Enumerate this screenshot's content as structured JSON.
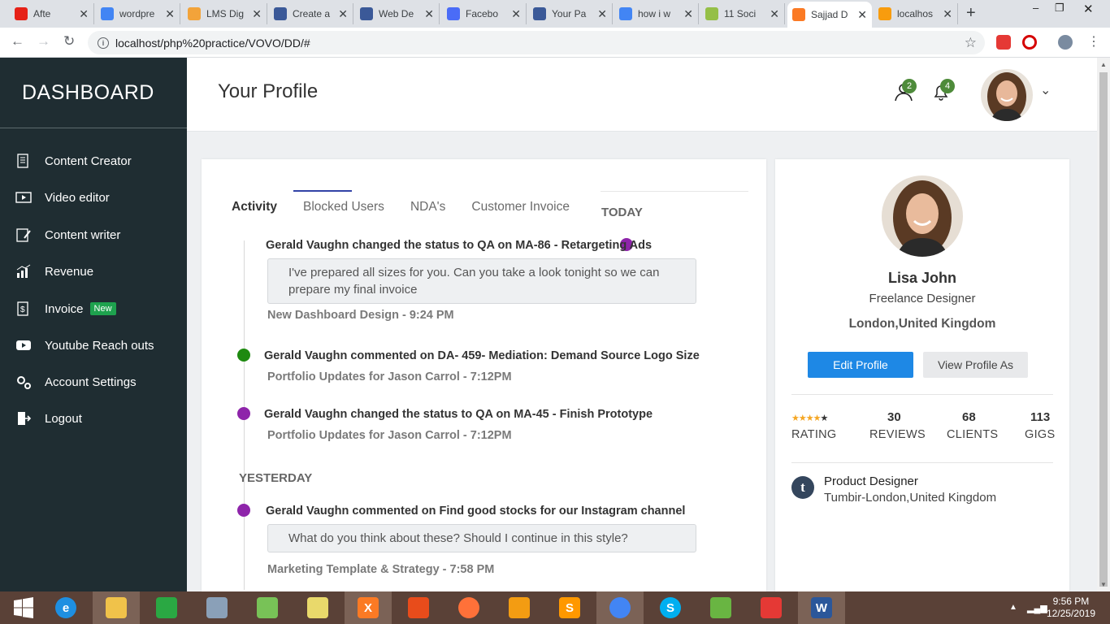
{
  "browser": {
    "tabs": [
      {
        "title": "Afte",
        "favicon": "youtube-icon",
        "color": "#e62117"
      },
      {
        "title": "wordpre",
        "favicon": "google-icon",
        "color": "#4285f4"
      },
      {
        "title": "LMS Dig",
        "favicon": "lms-icon",
        "color": "#f2a33a"
      },
      {
        "title": "Create a",
        "favicon": "facebook-icon",
        "color": "#3b5998"
      },
      {
        "title": "Web De",
        "favicon": "facebook-icon",
        "color": "#3b5998"
      },
      {
        "title": "Facebo",
        "favicon": "c-icon",
        "color": "#4a6cf7"
      },
      {
        "title": "Your Pa",
        "favicon": "facebook-icon",
        "color": "#3b5998"
      },
      {
        "title": "how i w",
        "favicon": "google-icon",
        "color": "#4285f4"
      },
      {
        "title": "11 Soci",
        "favicon": "shopify-icon",
        "color": "#95bf47"
      },
      {
        "title": "Sajjad D",
        "favicon": "xampp-icon",
        "color": "#fb7a24"
      },
      {
        "title": "localhos",
        "favicon": "pma-icon",
        "color": "#f89c0e"
      }
    ],
    "url": "localhost/php%20practice/VOVO/DD/#"
  },
  "sidebar": {
    "brand": "DASHBOARD",
    "items": [
      {
        "label": "Content Creator",
        "icon": "content-creator-icon"
      },
      {
        "label": "Video editor",
        "icon": "video-editor-icon"
      },
      {
        "label": "Content writer",
        "icon": "content-writer-icon"
      },
      {
        "label": "Revenue",
        "icon": "revenue-icon"
      },
      {
        "label": "Invoice",
        "icon": "invoice-icon",
        "badge": "New"
      },
      {
        "label": "Youtube Reach outs",
        "icon": "youtube-icon"
      },
      {
        "label": "Account Settings",
        "icon": "settings-icon"
      },
      {
        "label": "Logout",
        "icon": "logout-icon"
      }
    ]
  },
  "header": {
    "title": "Your Profile",
    "user_count": "2",
    "notification_count": "4"
  },
  "activity": {
    "tabs": [
      "Activity",
      "Blocked Users",
      "NDA's",
      "Customer Invoice"
    ],
    "today_label": "TODAY",
    "yesterday_label": "YESTERDAY",
    "events": [
      {
        "title": "Gerald Vaughn changed the status to QA on MA-86 - Retargeting Ads",
        "message": "I've prepared all sizes for you. Can you take a look tonight so we can prepare my final invoice",
        "sub": "New Dashboard Design - 9:24 PM",
        "dot_color": "#8e24aa"
      },
      {
        "title": "Gerald Vaughn commented on DA- 459- Mediation: Demand Source Logo Size",
        "sub": "Portfolio Updates for Jason Carrol - 7:12PM",
        "dot_color": "#1e8a10"
      },
      {
        "title": "Gerald Vaughn changed the status to QA on MA-45 - Finish Prototype",
        "sub": "Portfolio Updates for Jason Carrol - 7:12PM",
        "dot_color": "#8e24aa"
      },
      {
        "title": "Gerald Vaughn commented on Find good stocks for our Instagram channel",
        "message": "What do you think about these? Should I continue in this style?",
        "sub": "Marketing Template & Strategy - 7:58 PM",
        "dot_color": "#8e24aa"
      }
    ]
  },
  "profile": {
    "name": "Lisa John",
    "role": "Freelance Designer",
    "location": "London,United Kingdom",
    "edit_button": "Edit Profile",
    "view_button": "View Profile As",
    "rating_stars": 4.5,
    "stats": [
      {
        "label": "RATING",
        "value": ""
      },
      {
        "label": "REVIEWS",
        "value": "30"
      },
      {
        "label": "CLIENTS",
        "value": "68"
      },
      {
        "label": "GIGS",
        "value": "113"
      }
    ],
    "job_title": "Product Designer",
    "job_location": "Tumbir-London,United Kingdom",
    "job_icon": "tumblr-icon"
  },
  "taskbar": {
    "time": "9:56 PM",
    "date": "12/25/2019"
  },
  "colors": {
    "sidebar_bg": "#1f2d32",
    "accent": "#1e88e5",
    "badge_green": "#4e8b3a",
    "tab_indicator": "#3243a7"
  }
}
